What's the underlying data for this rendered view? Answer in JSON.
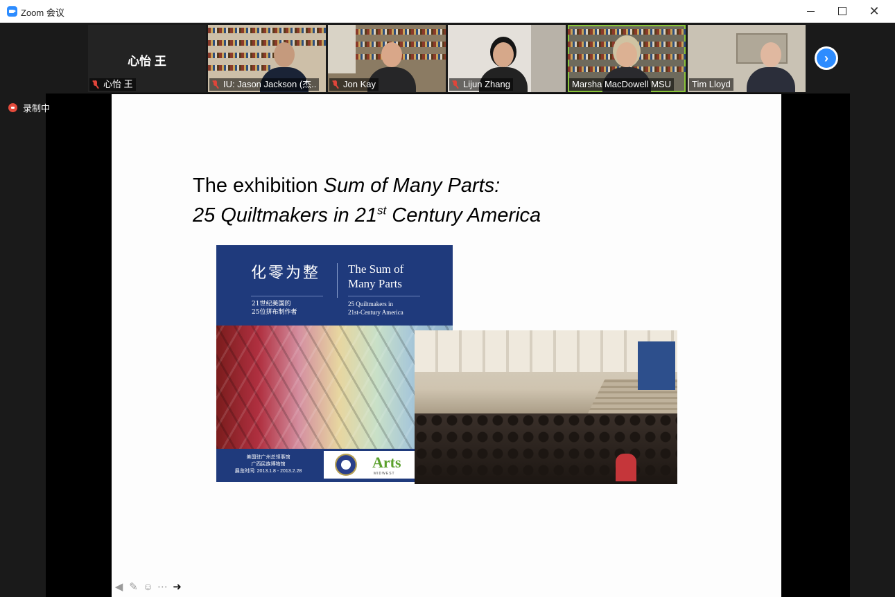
{
  "window": {
    "title": "Zoom 会议",
    "minimize": "—",
    "maximize": "☐",
    "close": "✕"
  },
  "participants": [
    {
      "name": "心怡 王",
      "display": "心怡 王",
      "muted": true,
      "video": false
    },
    {
      "name": "IU: Jason Jackson (杰..",
      "muted": true,
      "video": true
    },
    {
      "name": "Jon Kay",
      "muted": true,
      "video": true
    },
    {
      "name": "Lijun Zhang",
      "muted": true,
      "video": true
    },
    {
      "name": "Marsha MacDowell MSU",
      "muted": false,
      "video": true,
      "active_speaker": true
    },
    {
      "name": "Tim Lloyd",
      "muted": false,
      "video": true
    }
  ],
  "recording": {
    "label": "录制中"
  },
  "next_icon": "›",
  "slide": {
    "title_line1_plain": "The exhibition ",
    "title_line1_italic": "Sum of Many Parts:",
    "title_line2_a": "25 Quiltmakers in 21",
    "title_line2_sup": "st",
    "title_line2_b": " Century America"
  },
  "poster": {
    "cn_title": "化零为整",
    "en_title_1": "The Sum of",
    "en_title_2": "Many Parts",
    "cn_sub_1": "21世纪美国的",
    "cn_sub_2": "25位拼布制作者",
    "en_sub_1": "25 Quiltmakers in",
    "en_sub_2": "21st-Century America",
    "sponsor_1": "美国驻广州总领事馆",
    "sponsor_2": "广西民族博物馆",
    "sponsor_3": "展览时间: 2013.1.8 - 2013.2.28",
    "arts_logo": "Arts",
    "arts_sub": "MIDWEST"
  },
  "toolbar": {
    "back_icon": "arrow-left-icon",
    "pen_icon": "pen-icon",
    "icons": [
      "◀",
      "✎",
      "☺",
      "⋯",
      "➜"
    ]
  },
  "colors": {
    "zoom_blue": "#2d8cff",
    "active_speaker": "#8ac53a",
    "rec_red": "#e34a3b",
    "poster_blue": "#1f3a7c"
  }
}
